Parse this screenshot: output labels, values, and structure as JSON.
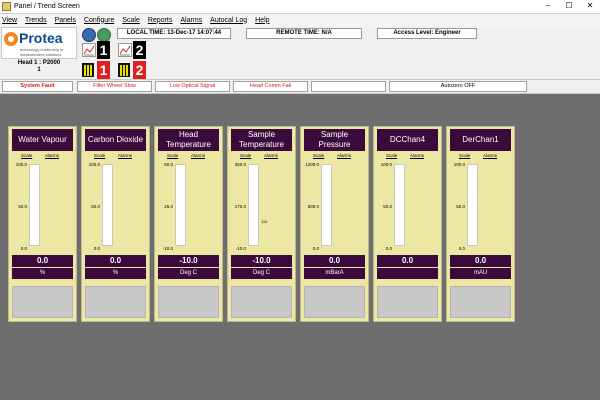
{
  "window": {
    "title": "Panel / Trend Screen",
    "controls": [
      "–",
      "☐",
      "✕"
    ]
  },
  "menu": [
    "View",
    "Trends",
    "Panels",
    "Configure",
    "Scale",
    "Reports",
    "Alarms",
    "Autocal Log",
    "Help"
  ],
  "logo": {
    "name": "Protea",
    "tagline": "technology leadership in measurement solutions"
  },
  "head": {
    "label": "Head 1 : P2000",
    "number": "1"
  },
  "toolbar_icons": {
    "digit_top": "1",
    "digit_top2": "2",
    "digit_bottom": "1",
    "digit_bottom2": "2"
  },
  "info": {
    "local_time": "LOCAL TIME: 13-Dec-17 14:07:44",
    "remote_time": "REMOTE TIME: N/A",
    "access_level": "Access Level: Engineer"
  },
  "status": {
    "cells": [
      "System Fault",
      "Filter Wheel Slow",
      "Low Optical Signal",
      "Head Comm Fail",
      "",
      "Autozero OFF"
    ]
  },
  "gauge_headers": {
    "scale": "Scale",
    "alarms": "Alarms"
  },
  "gauges": [
    {
      "title": "Water Vapour",
      "ticks": [
        "100.0",
        "50.0",
        "0.0"
      ],
      "value": "0.0",
      "unit": "%",
      "alarm": "",
      "fill": 0
    },
    {
      "title": "Carbon Dioxide",
      "ticks": [
        "100.0",
        "50.0",
        "0.0"
      ],
      "value": "0.0",
      "unit": "%",
      "alarm": "",
      "fill": 0
    },
    {
      "title": "Head Temperature",
      "ticks": [
        "60.0",
        "25.0",
        "-10.0"
      ],
      "value": "-10.0",
      "unit": "Deg C",
      "alarm": "",
      "fill": 0
    },
    {
      "title": "Sample Temperature",
      "ticks": [
        "350.0",
        "170.0",
        "-10.0"
      ],
      "value": "-10.0",
      "unit": "Deg C",
      "alarm": "110",
      "fill": 0
    },
    {
      "title": "Sample Pressure",
      "ticks": [
        "1200.0",
        "600.0",
        "0.0"
      ],
      "value": "0.0",
      "unit": "mBarA",
      "alarm": "",
      "fill": 0
    },
    {
      "title": "DCChan4",
      "ticks": [
        "100.0",
        "50.0",
        "0.0"
      ],
      "value": "0.0",
      "unit": "",
      "alarm": "",
      "fill": 0
    },
    {
      "title": "DerChan1",
      "ticks": [
        "100.0",
        "50.0",
        "0.0"
      ],
      "value": "0.0",
      "unit": "mAU",
      "alarm": "",
      "fill": 0
    }
  ]
}
